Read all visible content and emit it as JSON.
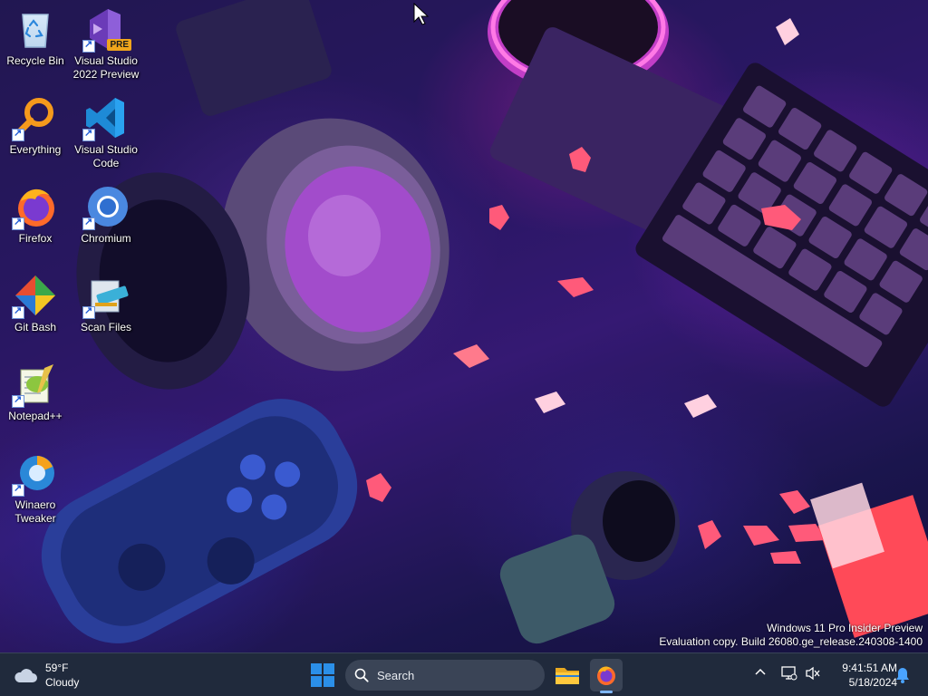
{
  "desktop": {
    "icons": [
      {
        "label": "Recycle Bin",
        "icon": "recycle-bin-icon"
      },
      {
        "label": "Visual Studio 2022 Preview",
        "icon": "visual-studio-icon",
        "badge": "PRE"
      },
      {
        "label": "Everything",
        "icon": "everything-search-icon"
      },
      {
        "label": "Visual Studio Code",
        "icon": "vscode-icon"
      },
      {
        "label": "Firefox",
        "icon": "firefox-icon"
      },
      {
        "label": "Chromium",
        "icon": "chromium-icon"
      },
      {
        "label": "Git Bash",
        "icon": "git-bash-icon"
      },
      {
        "label": "Scan Files",
        "icon": "scan-files-icon"
      },
      {
        "label": "Notepad++",
        "icon": "notepad-plus-plus-icon"
      },
      {
        "label": "Winaero Tweaker",
        "icon": "winaero-tweaker-icon"
      }
    ]
  },
  "watermark": {
    "line1": "Windows 11 Pro Insider Preview",
    "line2": "Evaluation copy. Build 26080.ge_release.240308-1400"
  },
  "taskbar": {
    "weather": {
      "temp": "59°F",
      "condition": "Cloudy",
      "icon": "cloud-icon"
    },
    "search": {
      "label": "Search"
    },
    "pinned": [
      {
        "name": "File Explorer",
        "icon": "folder-icon"
      },
      {
        "name": "Firefox",
        "icon": "firefox-icon",
        "active": true
      }
    ],
    "tray": {
      "chevron": "^",
      "time": "9:41:51 AM",
      "date": "5/18/2024"
    }
  },
  "colors": {
    "taskbar_bg": "#202a3c",
    "search_bg": "#3a4456",
    "accent": "#7fb7ff",
    "windows_blue": "#2b8fe8"
  }
}
